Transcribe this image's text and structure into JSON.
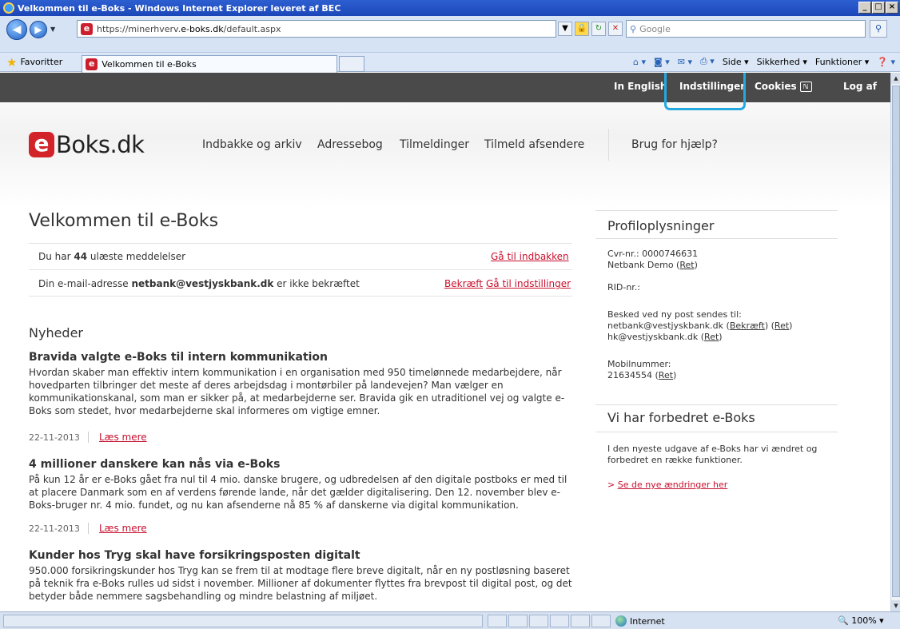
{
  "window": {
    "title": "Velkommen til e-Boks - Windows Internet Explorer leveret af BEC",
    "controls": [
      "_",
      "□",
      "×"
    ]
  },
  "addressbar": {
    "url_prefix": "https://minerhverv.",
    "url_host": "e-boks.dk",
    "url_path": "/default.aspx",
    "search_placeholder": "Google"
  },
  "favbar": {
    "favorites_label": "Favoritter",
    "tab_title": "Velkommen til e-Boks",
    "commands": [
      "Side ▾",
      "Sikkerhed ▾",
      "Funktioner ▾"
    ]
  },
  "topnav": {
    "english": "In English",
    "settings": "Indstillinger",
    "cookies": "Cookies",
    "logout": "Log af"
  },
  "logo": {
    "badge": "e",
    "text": "Boks.dk"
  },
  "mainnav": {
    "inbox": "Indbakke og arkiv",
    "addressbook": "Adressebog",
    "subscriptions": "Tilmeldinger",
    "subscribe_senders": "Tilmeld afsendere",
    "help": "Brug for hjælp?"
  },
  "welcome": {
    "title": "Velkommen til e-Boks",
    "unread_pre": "Du har ",
    "unread_count": "44",
    "unread_post": " ulæste meddelelser",
    "unread_link": "Gå til indbakken",
    "email_pre": "Din e-mail-adresse ",
    "email": "netbank@vestjyskbank.dk",
    "email_post": " er ikke bekræftet",
    "confirm_link": "Bekræft",
    "settings_link": "Gå til indstillinger"
  },
  "news": {
    "heading": "Nyheder",
    "articles": [
      {
        "title": "Bravida valgte e-Boks til intern kommunikation",
        "body": "Hvordan skaber man effektiv intern kommunikation i en organisation med 950 timelønnede medarbejdere, når hovedparten tilbringer det meste af deres arbejdsdag i montørbiler på landevejen? Man vælger en kommunikationskanal, som man er sikker på, at medarbejderne ser. Bravida gik en utraditionel vej og valgte e-Boks som stedet, hvor medarbejderne skal informeres om vigtige emner.",
        "date": "22-11-2013",
        "more": "Læs mere"
      },
      {
        "title": "4 millioner danskere kan nås via e-Boks",
        "body": "På kun 12 år er e-Boks gået fra nul til 4 mio. danske brugere, og udbredelsen af den digitale postboks er med til at placere Danmark som en af verdens førende lande, når det gælder digitalisering. Den 12. november blev e-Boks-bruger nr. 4 mio. fundet, og nu kan afsenderne nå 85 % af danskerne via digital kommunikation.",
        "date": "22-11-2013",
        "more": "Læs mere"
      },
      {
        "title": "Kunder hos Tryg skal have forsikringsposten digitalt",
        "body": "950.000 forsikringskunder hos Tryg kan se frem til at modtage flere breve digitalt, når en ny postløsning baseret på teknik fra e-Boks rulles ud sidst i november. Millioner af dokumenter flyttes fra brevpost til digital post, og det betyder både nemmere sagsbehandling og mindre belastning af miljøet."
      }
    ]
  },
  "profile": {
    "heading": "Profiloplysninger",
    "cvr": "Cvr-nr.: 0000746631",
    "company": "Netbank Demo",
    "ret": "Ret",
    "rid": "RID-nr.:",
    "post_label": "Besked ved ny post sendes til:",
    "post_email1": "netbank@vestjyskbank.dk",
    "confirm": "Bekræft",
    "post_email2": "hk@vestjyskbank.dk",
    "mobile_label": "Mobilnummer:",
    "mobile": "21634554"
  },
  "improved": {
    "heading": "Vi har forbedret e-Boks",
    "body": "I den nyeste udgave af e-Boks har vi ændret og forbedret en række funktioner.",
    "link": "Se de nye ændringer her"
  },
  "statusbar": {
    "zone": "Internet",
    "zoom": "100%"
  }
}
